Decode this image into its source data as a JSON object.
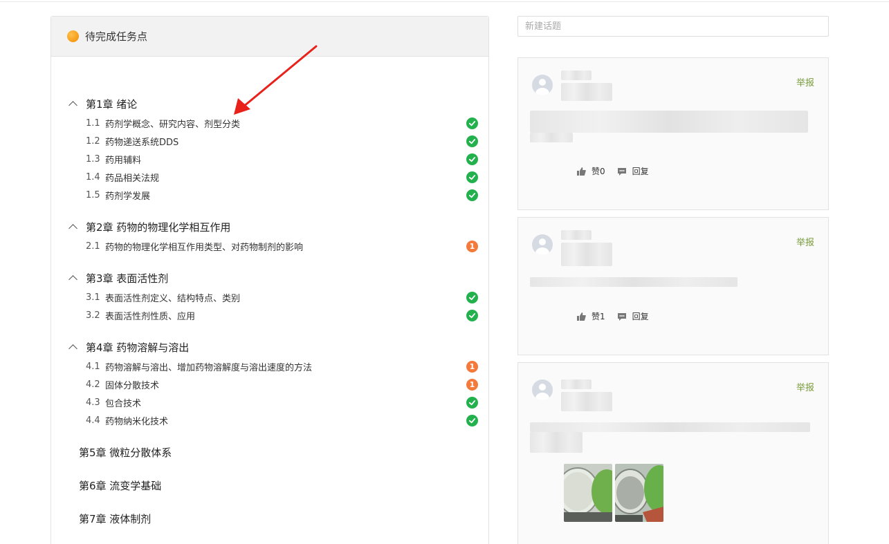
{
  "left_panel": {
    "title": "待完成任务点",
    "chapters": [
      {
        "title": "第1章 绪论",
        "sections": [
          {
            "num": "1.1",
            "name": "药剂学概念、研究内容、剂型分类",
            "status": "done"
          },
          {
            "num": "1.2",
            "name": "药物递送系统DDS",
            "status": "done"
          },
          {
            "num": "1.3",
            "name": "药用辅料",
            "status": "done"
          },
          {
            "num": "1.4",
            "name": "药品相关法规",
            "status": "done"
          },
          {
            "num": "1.5",
            "name": "药剂学发展",
            "status": "done"
          }
        ]
      },
      {
        "title": "第2章 药物的物理化学相互作用",
        "sections": [
          {
            "num": "2.1",
            "name": "药物的物理化学相互作用类型、对药物制剂的影响",
            "status": "pending",
            "count": "1"
          }
        ]
      },
      {
        "title": "第3章 表面活性剂",
        "sections": [
          {
            "num": "3.1",
            "name": "表面活性剂定义、结构特点、类别",
            "status": "done"
          },
          {
            "num": "3.2",
            "name": "表面活性剂性质、应用",
            "status": "done"
          }
        ]
      },
      {
        "title": "第4章 药物溶解与溶出",
        "sections": [
          {
            "num": "4.1",
            "name": "药物溶解与溶出、增加药物溶解度与溶出速度的方法",
            "status": "pending",
            "count": "1"
          },
          {
            "num": "4.2",
            "name": "固体分散技术",
            "status": "pending",
            "count": "1"
          },
          {
            "num": "4.3",
            "name": "包合技术",
            "status": "done"
          },
          {
            "num": "4.4",
            "name": "药物纳米化技术",
            "status": "done"
          }
        ]
      },
      {
        "title": "第5章 微粒分散体系",
        "sections": []
      },
      {
        "title": "第6章 流变学基础",
        "sections": []
      },
      {
        "title": "第7章 液体制剂",
        "sections": []
      }
    ]
  },
  "right_panel": {
    "new_topic_placeholder": "新建话题",
    "posts": [
      {
        "report_label": "举报",
        "like_label": "赞0",
        "reply_label": "回复"
      },
      {
        "report_label": "举报",
        "like_label": "赞1",
        "reply_label": "回复"
      },
      {
        "report_label": "举报"
      }
    ]
  },
  "colors": {
    "done": "#22b14c",
    "pending": "#f47a3b",
    "report": "#7a9c3e",
    "arrow": "#e8211b"
  },
  "icons": [
    "orange-dot-icon",
    "chevron-up-icon",
    "check-circle-icon",
    "pending-count-icon",
    "thumbs-up-icon",
    "comment-icon",
    "avatar-icon"
  ]
}
